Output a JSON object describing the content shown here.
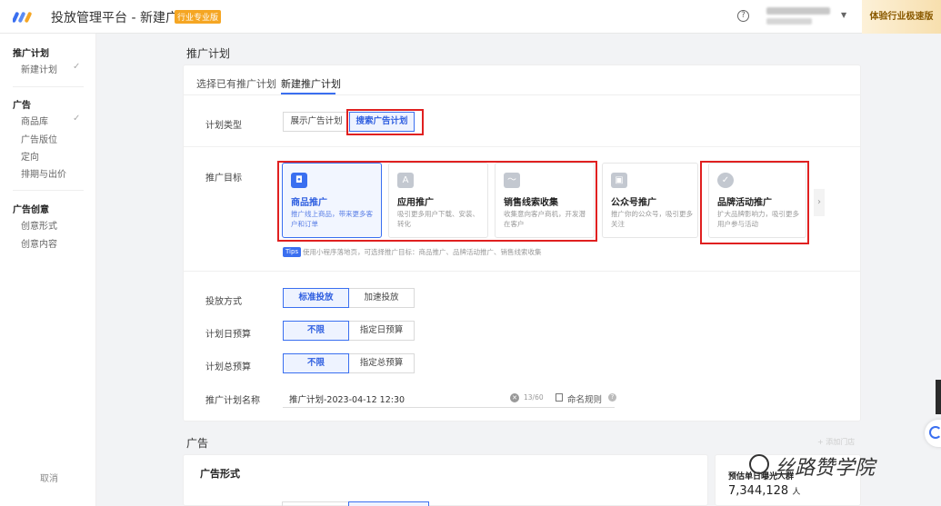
{
  "header": {
    "app_title": "投放管理平台 - 新建广告",
    "pro_badge": "行业专业版",
    "help_icon": "?",
    "trial_badge": "体验行业极速版"
  },
  "sidebar": {
    "sections": [
      {
        "title": "推广计划",
        "items": [
          {
            "label": "新建计划",
            "done": true
          }
        ]
      },
      {
        "title": "广告",
        "items": [
          {
            "label": "商品库",
            "done": true
          },
          {
            "label": "广告版位"
          },
          {
            "label": "定向"
          },
          {
            "label": "排期与出价"
          }
        ]
      },
      {
        "title": "广告创意",
        "items": [
          {
            "label": "创意形式"
          },
          {
            "label": "创意内容"
          }
        ]
      }
    ],
    "check_glyph": "✓",
    "cancel": "取消"
  },
  "plan": {
    "section_title": "推广计划",
    "tabs": [
      "选择已有推广计划",
      "新建推广计划"
    ],
    "active_tab": 1,
    "plan_type": {
      "label": "计划类型",
      "options": [
        "展示广告计划",
        "搜索广告计划"
      ],
      "selected": 1
    },
    "goal": {
      "label": "推广目标",
      "cards": [
        {
          "icon": "shopping-bag-icon",
          "glyph": "◘",
          "title": "商品推广",
          "desc": "推广线上商品，带来更多客户和订单",
          "selected": true
        },
        {
          "icon": "app-store-icon",
          "glyph": "A",
          "title": "应用推广",
          "desc": "吸引更多用户下载、安装、转化"
        },
        {
          "icon": "leads-chart-icon",
          "glyph": "〜",
          "title": "销售线索收集",
          "desc": "收集意向客户商机，开发潜在客户"
        },
        {
          "icon": "profile-card-icon",
          "glyph": "▣",
          "title": "公众号推广",
          "desc": "推广你的公众号，吸引更多关注"
        },
        {
          "icon": "brand-chat-icon",
          "glyph": "✓",
          "title": "品牌活动推广",
          "desc": "扩大品牌影响力，吸引更多用户参与活动"
        }
      ],
      "next_arrow": "›",
      "tips_badge": "Tips",
      "tips_text": "使用小程序落地页，可选择推广目标：商品推广、品牌活动推广、销售线索收集"
    },
    "delivery": {
      "label": "投放方式",
      "options": [
        "标准投放",
        "加速投放"
      ],
      "selected": 0
    },
    "daily_budget": {
      "label": "计划日预算",
      "options": [
        "不限",
        "指定日预算"
      ],
      "selected": 0
    },
    "total_budget": {
      "label": "计划总预算",
      "options": [
        "不限",
        "指定总预算"
      ],
      "selected": 0
    },
    "name": {
      "label": "推广计划名称",
      "value": "推广计划-2023-04-12 12:30",
      "clear_glyph": "✕",
      "counter": "13/60",
      "rule_label": "命名规则",
      "rule_help": "?"
    }
  },
  "ad": {
    "section_title": "广告",
    "add_store": "+ 添加门店",
    "format_title": "广告形式",
    "estimate_label": "预估单日曝光人群",
    "estimate_value": "7,344,128",
    "estimate_unit": "人"
  },
  "watermark": "丝路赞学院",
  "colors": {
    "accent": "#3a6ff0",
    "highlight": "#e02020",
    "badge": "#f5a623"
  }
}
